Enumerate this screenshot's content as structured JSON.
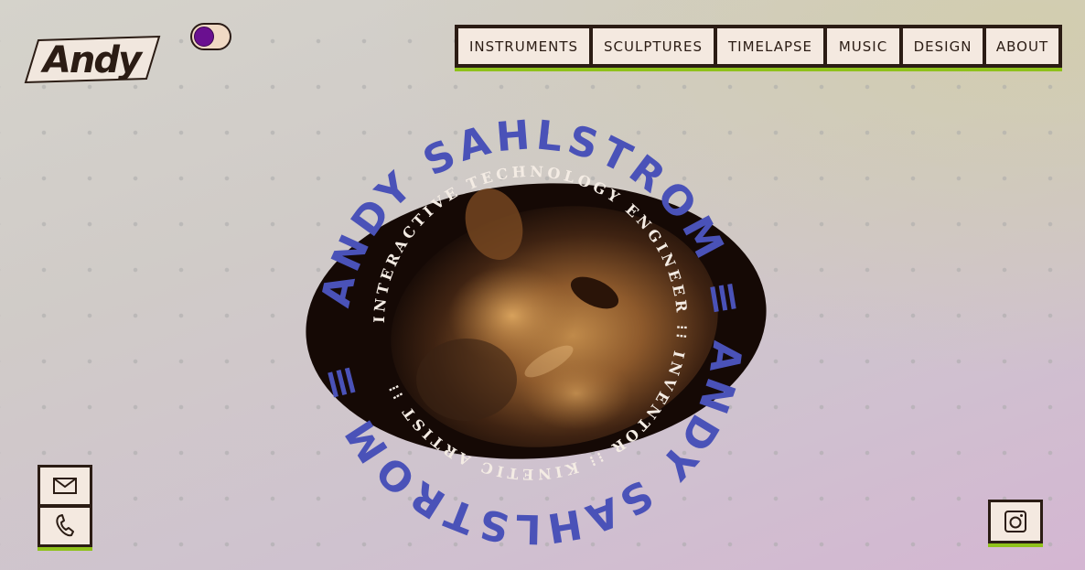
{
  "logo": {
    "text": "Andy"
  },
  "theme_toggle": {
    "label": "Theme toggle",
    "accent": "#6a1090"
  },
  "nav": {
    "items": [
      {
        "label": "INSTRUMENTS"
      },
      {
        "label": "SCULPTURES"
      },
      {
        "label": "TIMELAPSE"
      },
      {
        "label": "MUSIC"
      },
      {
        "label": "DESIGN"
      },
      {
        "label": "ABOUT"
      }
    ]
  },
  "hero": {
    "outer_ring_text": "ANDY SAHLSTROM ≡ ANDY SAHLSTROM ≡",
    "inner_ring_text": "INTERACTIVE TECHNOLOGY ENGINEER ⁝⁝ INVENTOR ⁝⁝ KINETIC ARTIST ⁝⁝",
    "portrait_alt": "Close-up portrait of Andy Sahlstrom",
    "colors": {
      "outer_ring": "#4a52b8",
      "inner_ring": "#f4ece4",
      "accent": "#8fc11b",
      "ink": "#2b1c14"
    }
  },
  "contact": {
    "email_label": "Email",
    "phone_label": "Phone"
  },
  "social": {
    "instagram_label": "Instagram"
  }
}
